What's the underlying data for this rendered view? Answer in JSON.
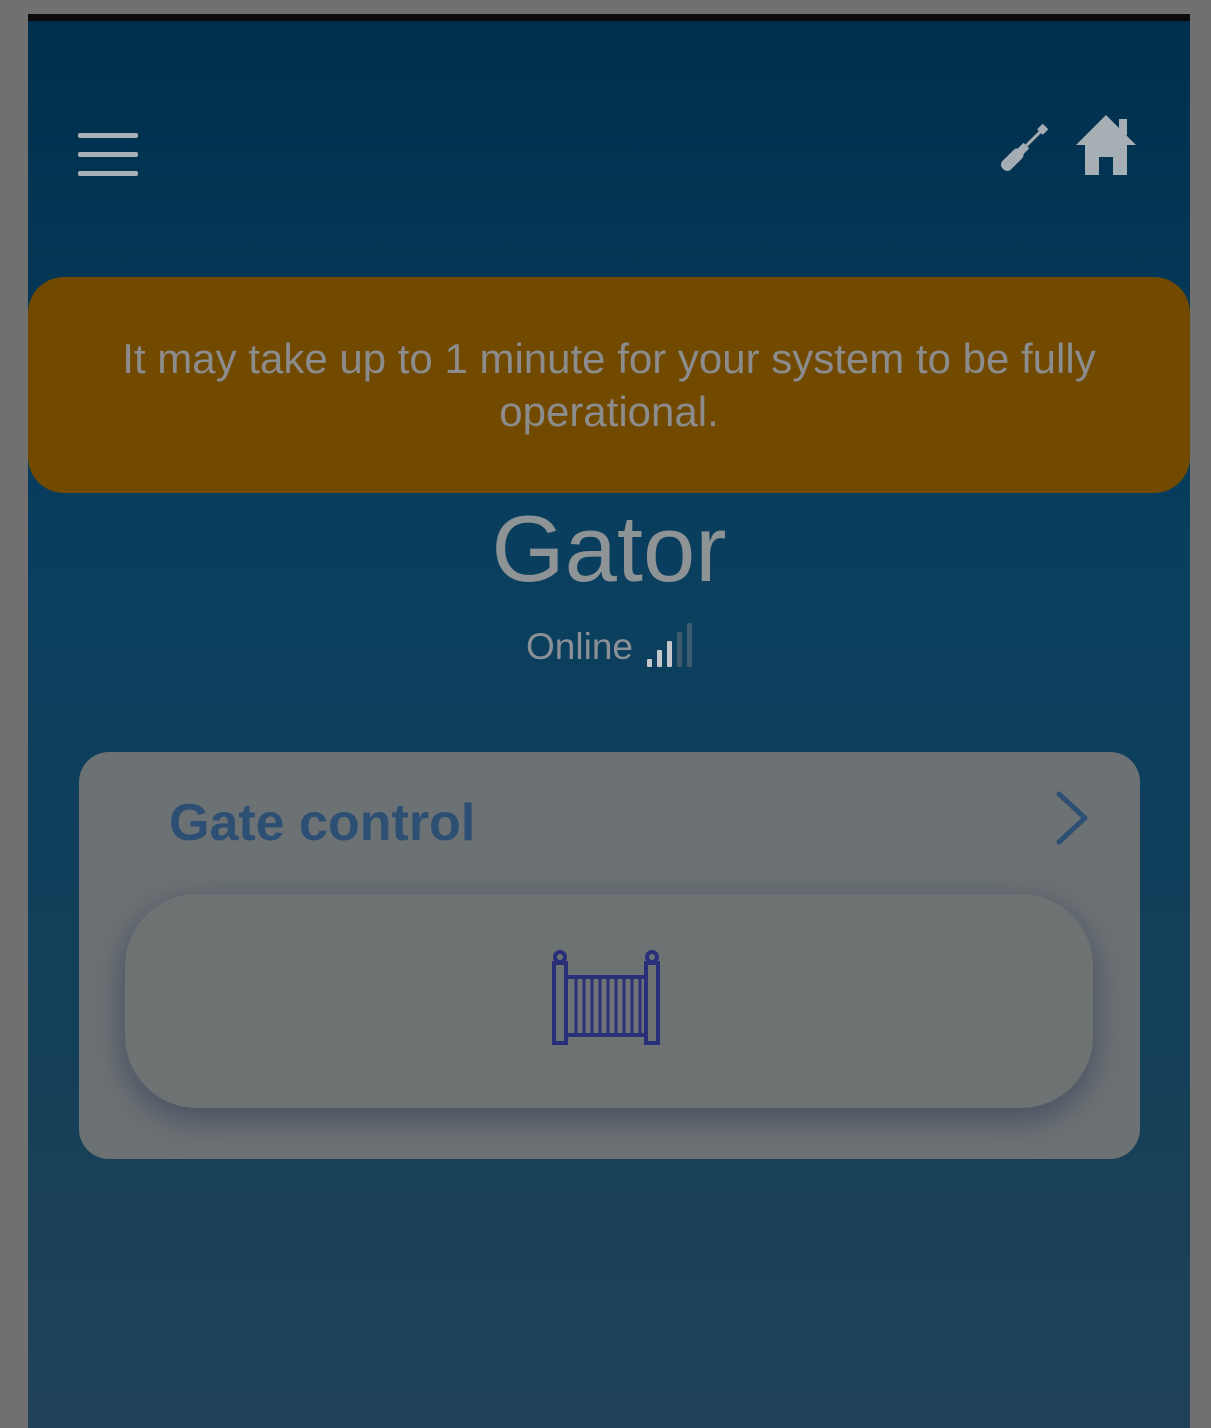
{
  "header": {
    "menu_icon": "hamburger-menu-icon",
    "tool_icon": "screwdriver-icon",
    "home_icon": "home-icon"
  },
  "notice": {
    "text": "It may take up to 1 minute for your system to be fully operational."
  },
  "device": {
    "name": "Gator",
    "status": "Online",
    "signal_bars_active": 3,
    "signal_bars_total": 5
  },
  "gate_card": {
    "title": "Gate control",
    "chevron_icon": "chevron-right-icon",
    "button_icon": "gate-icon"
  },
  "colors": {
    "banner": "#714a00",
    "card_title": "#2c4f73",
    "gate_icon": "#2a2f7a",
    "signal_active": "#c3c7ca",
    "signal_inactive": "#3e5a6e"
  }
}
